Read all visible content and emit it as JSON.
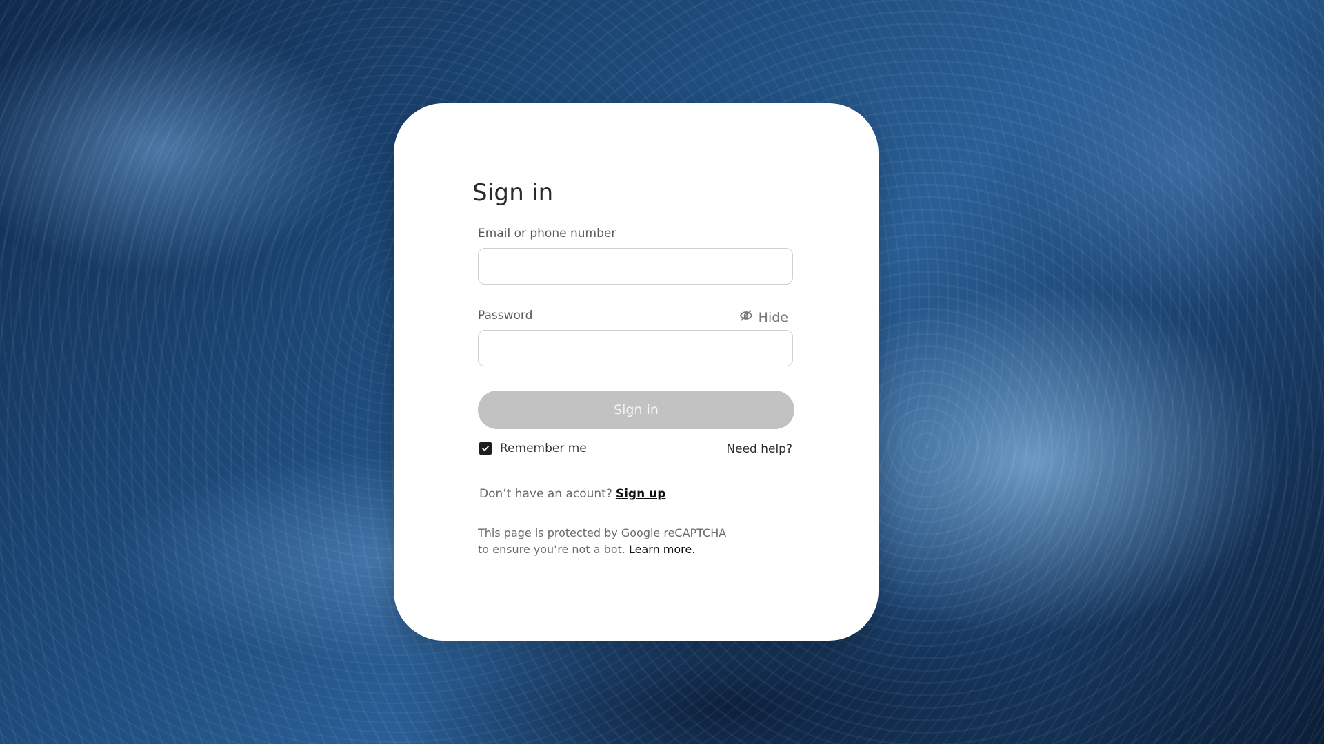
{
  "form": {
    "title": "Sign in",
    "email_label": "Email or phone number",
    "email_value": "",
    "email_placeholder": "",
    "password_label": "Password",
    "password_value": "",
    "password_placeholder": "",
    "hide_label": "Hide",
    "hide_icon": "eye-slash-icon",
    "submit_label": "Sign in",
    "remember_label": "Remember me",
    "remember_checked": true,
    "need_help_label": "Need help?",
    "signup_prompt": "Don’t have an acount?",
    "signup_link": "Sign up",
    "recaptcha_line1": "This page is protected by Google reCAPTCHA",
    "recaptcha_line2": "to ensure you’re not a bot.",
    "learn_more": "Learn more."
  },
  "colors": {
    "card_bg": "#ffffff",
    "button_disabled_bg": "#c2c2c2",
    "button_text": "#f4f4f4",
    "checkbox_fill": "#1e1e1e"
  },
  "background": {
    "description_icon": "ocean-waves-image"
  }
}
